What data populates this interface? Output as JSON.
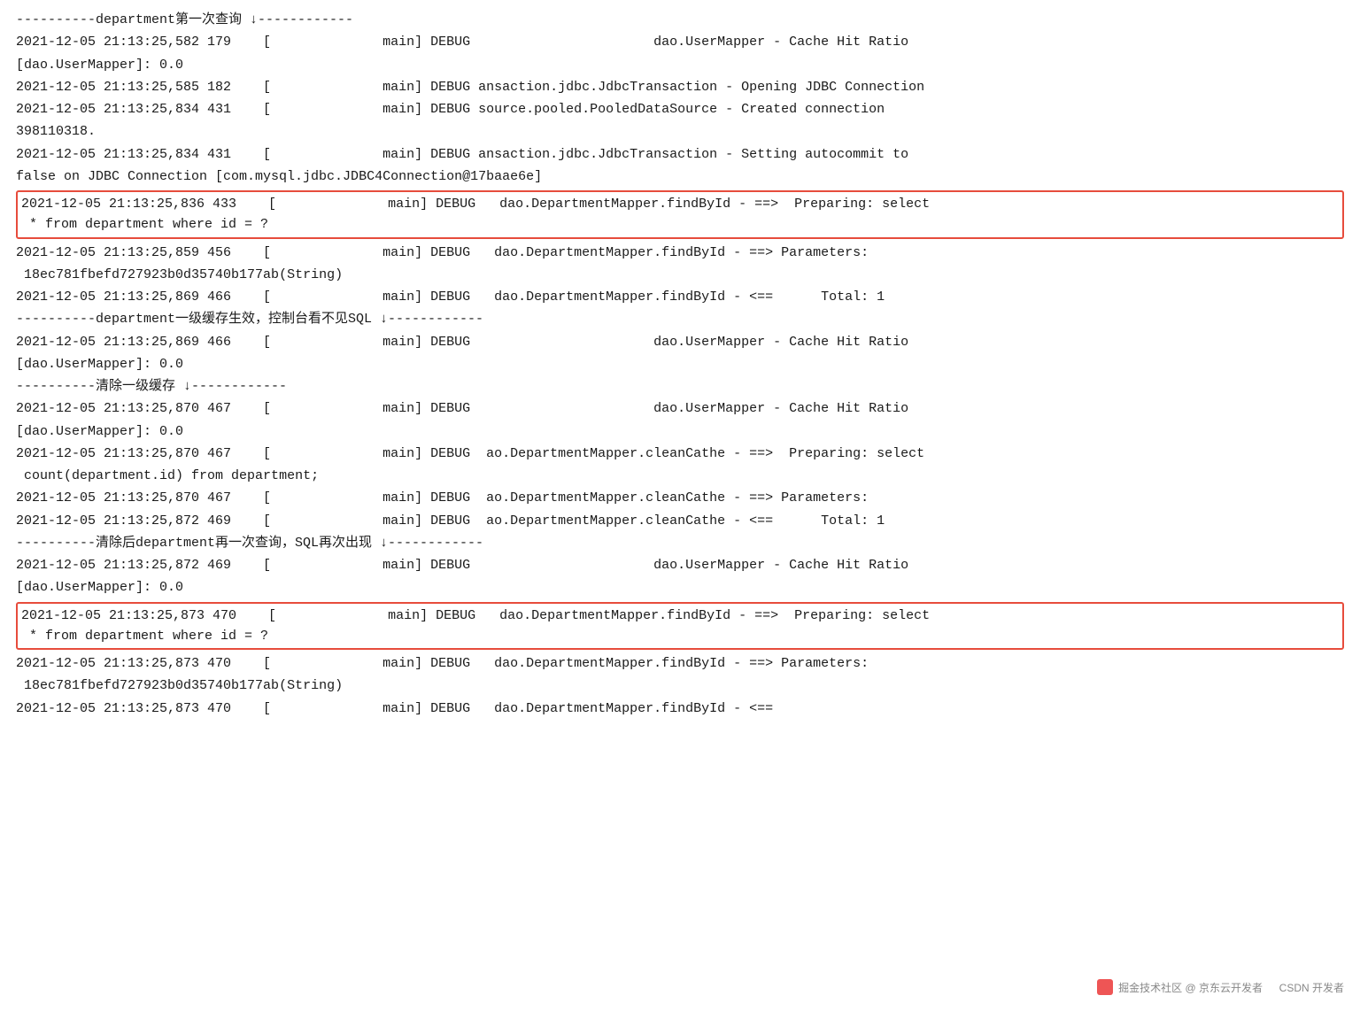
{
  "logs": [
    {
      "id": "header1",
      "text": "----------department第一次查询 ↓------------",
      "type": "comment",
      "highlight": false
    },
    {
      "id": "l1",
      "text": "2021-12-05 21:13:25,582 179    [              main] DEBUG                       dao.UserMapper - Cache Hit Ratio",
      "type": "log",
      "highlight": false
    },
    {
      "id": "l2",
      "text": "[dao.UserMapper]: 0.0",
      "type": "log",
      "highlight": false
    },
    {
      "id": "l3",
      "text": "2021-12-05 21:13:25,585 182    [              main] DEBUG ansaction.jdbc.JdbcTransaction - Opening JDBC Connection",
      "type": "log",
      "highlight": false
    },
    {
      "id": "l4",
      "text": "2021-12-05 21:13:25,834 431    [              main] DEBUG source.pooled.PooledDataSource - Created connection",
      "type": "log",
      "highlight": false
    },
    {
      "id": "l5",
      "text": "398110318.",
      "type": "log",
      "highlight": false
    },
    {
      "id": "l6",
      "text": "2021-12-05 21:13:25,834 431    [              main] DEBUG ansaction.jdbc.JdbcTransaction - Setting autocommit to",
      "type": "log",
      "highlight": false
    },
    {
      "id": "l7",
      "text": "false on JDBC Connection [com.mysql.jdbc.JDBC4Connection@17baae6e]",
      "type": "log",
      "highlight": false
    },
    {
      "id": "h1a",
      "text": "2021-12-05 21:13:25,836 433    [              main] DEBUG   dao.DepartmentMapper.findById - ==>  Preparing: select",
      "type": "log",
      "highlight": true
    },
    {
      "id": "h1b",
      "text": " * from department where id = ?",
      "type": "log",
      "highlight": true,
      "highlight_continuation": true
    },
    {
      "id": "l8",
      "text": "2021-12-05 21:13:25,859 456    [              main] DEBUG   dao.DepartmentMapper.findById - ==> Parameters:",
      "type": "log",
      "highlight": false
    },
    {
      "id": "l9",
      "text": " 18ec781fbefd727923b0d35740b177ab(String)",
      "type": "log",
      "highlight": false
    },
    {
      "id": "l10",
      "text": "2021-12-05 21:13:25,869 466    [              main] DEBUG   dao.DepartmentMapper.findById - <==      Total: 1",
      "type": "log",
      "highlight": false
    },
    {
      "id": "header2",
      "text": "----------department一级缓存生效，控制台看不见SQL ↓------------",
      "type": "comment",
      "highlight": false
    },
    {
      "id": "l11",
      "text": "2021-12-05 21:13:25,869 466    [              main] DEBUG                       dao.UserMapper - Cache Hit Ratio",
      "type": "log",
      "highlight": false
    },
    {
      "id": "l12",
      "text": "[dao.UserMapper]: 0.0",
      "type": "log",
      "highlight": false
    },
    {
      "id": "header3",
      "text": "----------清除一级缓存 ↓------------",
      "type": "comment",
      "highlight": false
    },
    {
      "id": "l13",
      "text": "2021-12-05 21:13:25,870 467    [              main] DEBUG                       dao.UserMapper - Cache Hit Ratio",
      "type": "log",
      "highlight": false
    },
    {
      "id": "l14",
      "text": "[dao.UserMapper]: 0.0",
      "type": "log",
      "highlight": false
    },
    {
      "id": "l15",
      "text": "2021-12-05 21:13:25,870 467    [              main] DEBUG  ao.DepartmentMapper.cleanCathe - ==>  Preparing: select",
      "type": "log",
      "highlight": false
    },
    {
      "id": "l16",
      "text": " count(department.id) from department;",
      "type": "log",
      "highlight": false
    },
    {
      "id": "l17",
      "text": "2021-12-05 21:13:25,870 467    [              main] DEBUG  ao.DepartmentMapper.cleanCathe - ==> Parameters:",
      "type": "log",
      "highlight": false
    },
    {
      "id": "l18",
      "text": "2021-12-05 21:13:25,872 469    [              main] DEBUG  ao.DepartmentMapper.cleanCathe - <==      Total: 1",
      "type": "log",
      "highlight": false
    },
    {
      "id": "header4",
      "text": "----------清除后department再一次查询，SQL再次出现 ↓------------",
      "type": "comment",
      "highlight": false
    },
    {
      "id": "l19",
      "text": "2021-12-05 21:13:25,872 469    [              main] DEBUG                       dao.UserMapper - Cache Hit Ratio",
      "type": "log",
      "highlight": false
    },
    {
      "id": "l20",
      "text": "[dao.UserMapper]: 0.0",
      "type": "log",
      "highlight": false
    },
    {
      "id": "h2a",
      "text": "2021-12-05 21:13:25,873 470    [              main] DEBUG   dao.DepartmentMapper.findById - ==>  Preparing: select",
      "type": "log",
      "highlight": true
    },
    {
      "id": "h2b",
      "text": " * from department where id = ?",
      "type": "log",
      "highlight": true,
      "highlight_continuation": true
    },
    {
      "id": "l21",
      "text": "2021-12-05 21:13:25,873 470    [              main] DEBUG   dao.DepartmentMapper.findById - ==> Parameters:",
      "type": "log",
      "highlight": false
    },
    {
      "id": "l22",
      "text": " 18ec781fbefd727923b0d35740b177ab(String)",
      "type": "log",
      "highlight": false
    },
    {
      "id": "l23",
      "text": "2021-12-05 21:13:25,873 470    [              main] DEBUG   dao.DepartmentMapper.findById - <==",
      "type": "log",
      "highlight": false
    }
  ],
  "watermark": {
    "text1": "掘金技术社区 @ 京东云开发者",
    "text2": "CSDN  开发者"
  }
}
